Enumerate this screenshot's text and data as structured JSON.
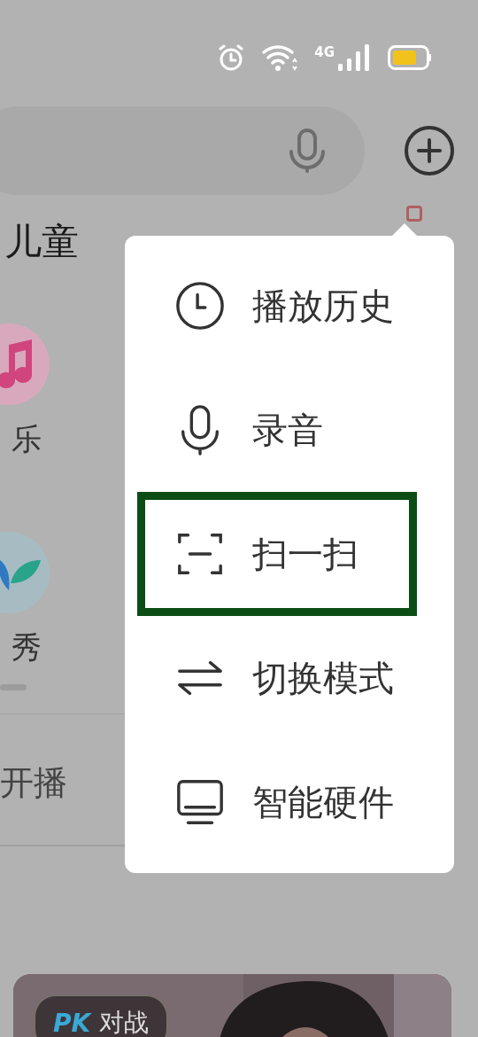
{
  "status_bar": {
    "network": "4G"
  },
  "tabs": [
    {
      "label": "儿童"
    }
  ],
  "categories": [
    {
      "label": "乐",
      "kind": "music"
    },
    {
      "label": "秀",
      "kind": "sprout"
    }
  ],
  "live_section": {
    "label": "开播"
  },
  "card": {
    "badge_logo": "PK",
    "badge_label": "对战",
    "kind": "picture"
  },
  "menu": {
    "items": [
      {
        "label": "播放历史",
        "kind": "clock",
        "highlighted": false
      },
      {
        "label": "录音",
        "kind": "mic",
        "highlighted": false
      },
      {
        "label": "扫一扫",
        "kind": "scan",
        "highlighted": true
      },
      {
        "label": "切换模式",
        "kind": "swap",
        "highlighted": false
      },
      {
        "label": "智能硬件",
        "kind": "monitor",
        "highlighted": false
      }
    ]
  }
}
